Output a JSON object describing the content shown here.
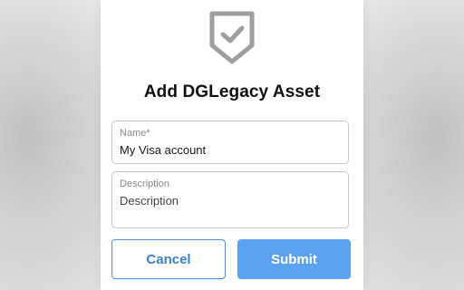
{
  "form": {
    "title": "Add DGLegacy Asset",
    "badge_icon": "shield-check-icon",
    "name_field": {
      "label": "Name*",
      "value": "My Visa account"
    },
    "description_field": {
      "label": "Description",
      "placeholder": "Description"
    },
    "cancel_label": "Cancel",
    "submit_label": "Submit"
  },
  "colors": {
    "accent": "#4a90e2",
    "submit_bg": "#5ba2f2",
    "icon": "#9e9e9e"
  }
}
